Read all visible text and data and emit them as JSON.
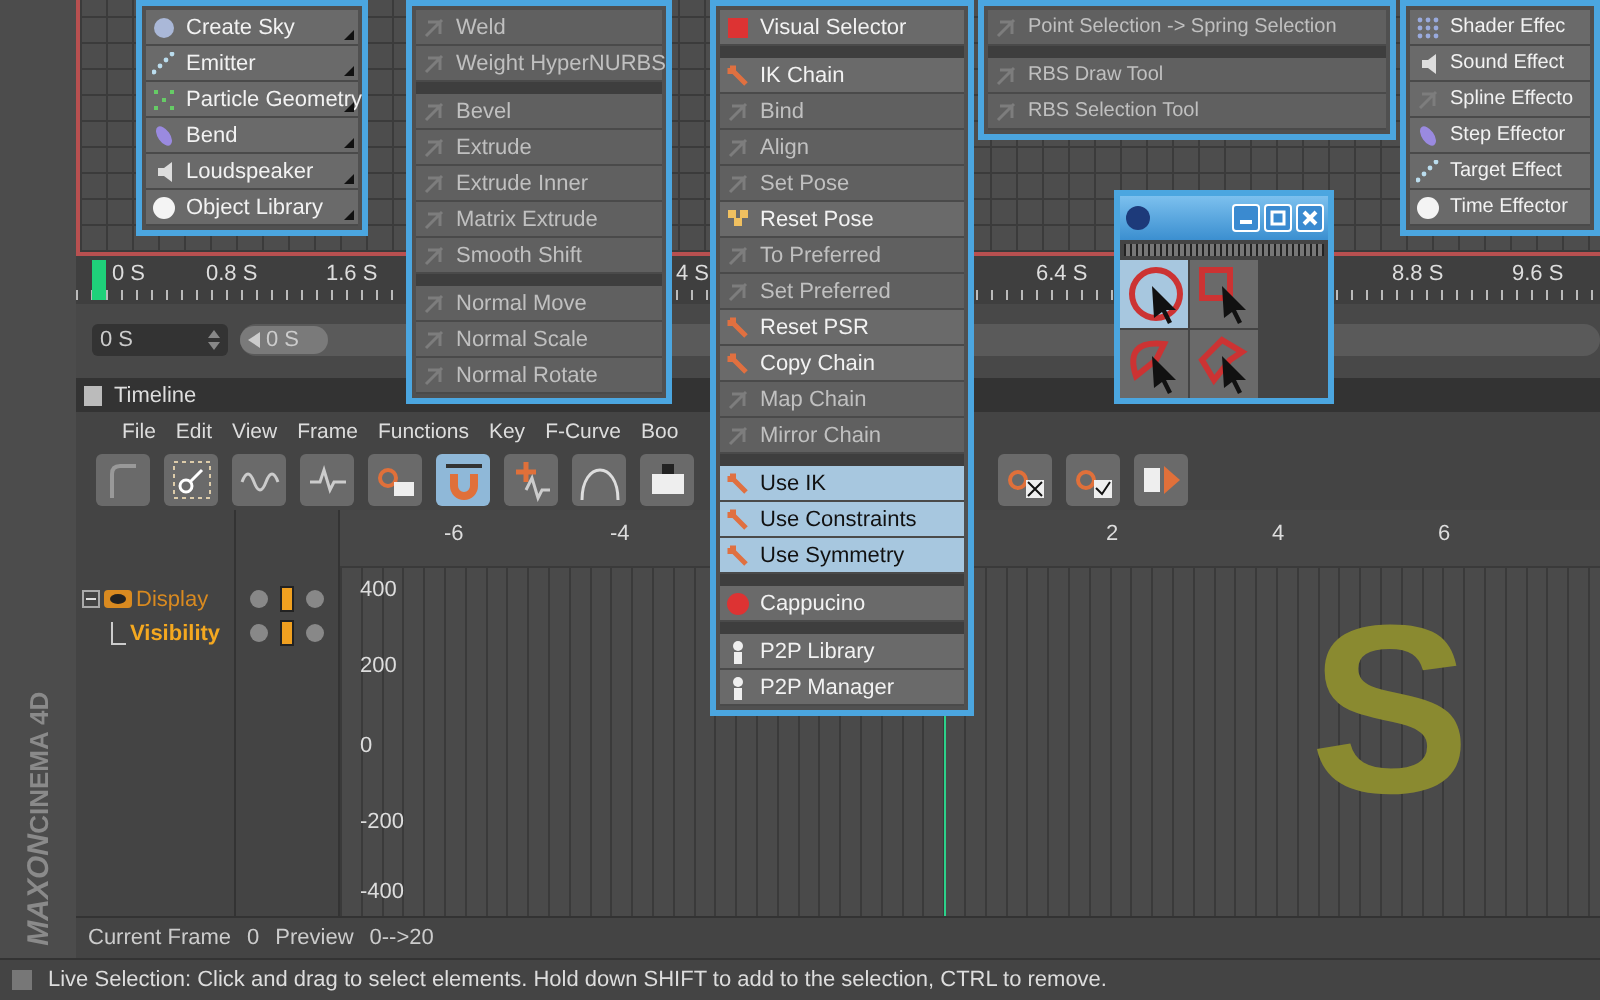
{
  "viewport": {
    "ruler": [
      "0 S",
      "0.8 S",
      "1.6 S",
      "4 S",
      "6.4 S",
      "8.8 S",
      "9.6 S"
    ],
    "frame_field": {
      "value": "0 S"
    },
    "time_slider": {
      "value": "0 S",
      "level": 0
    }
  },
  "menus": [
    {
      "items": [
        {
          "kind": "item",
          "label": "Create Sky",
          "disabled": false,
          "submenu": true
        },
        {
          "kind": "item",
          "label": "Emitter",
          "disabled": false,
          "submenu": true
        },
        {
          "kind": "item",
          "label": "Particle Geometry",
          "disabled": false,
          "submenu": true
        },
        {
          "kind": "item",
          "label": "Bend",
          "disabled": false,
          "submenu": true
        },
        {
          "kind": "item",
          "label": "Loudspeaker",
          "disabled": false,
          "submenu": true
        },
        {
          "kind": "item",
          "label": "Object Library",
          "disabled": false,
          "submenu": true
        }
      ]
    },
    {
      "items": [
        {
          "kind": "item",
          "label": "Weld",
          "disabled": true
        },
        {
          "kind": "item",
          "label": "Weight HyperNURBS",
          "disabled": true
        },
        {
          "kind": "separator"
        },
        {
          "kind": "item",
          "label": "Bevel",
          "disabled": true
        },
        {
          "kind": "item",
          "label": "Extrude",
          "disabled": true
        },
        {
          "kind": "item",
          "label": "Extrude Inner",
          "disabled": true
        },
        {
          "kind": "item",
          "label": "Matrix Extrude",
          "disabled": true
        },
        {
          "kind": "item",
          "label": "Smooth Shift",
          "disabled": true
        },
        {
          "kind": "separator"
        },
        {
          "kind": "item",
          "label": "Normal Move",
          "disabled": true
        },
        {
          "kind": "item",
          "label": "Normal Scale",
          "disabled": true
        },
        {
          "kind": "item",
          "label": "Normal Rotate",
          "disabled": true
        }
      ]
    },
    {
      "items": [
        {
          "kind": "item",
          "label": "Visual Selector",
          "disabled": false,
          "checked": false
        },
        {
          "kind": "separator"
        },
        {
          "kind": "item",
          "label": "IK Chain",
          "disabled": false,
          "checked": false
        },
        {
          "kind": "item",
          "label": "Bind",
          "disabled": true,
          "checked": false
        },
        {
          "kind": "item",
          "label": "Align",
          "disabled": true,
          "checked": false
        },
        {
          "kind": "item",
          "label": "Set Pose",
          "disabled": true,
          "checked": false
        },
        {
          "kind": "item",
          "label": "Reset Pose",
          "disabled": false,
          "checked": false
        },
        {
          "kind": "item",
          "label": "To Preferred",
          "disabled": true,
          "checked": false
        },
        {
          "kind": "item",
          "label": "Set Preferred",
          "disabled": true,
          "checked": false
        },
        {
          "kind": "item",
          "label": "Reset PSR",
          "disabled": false,
          "checked": false
        },
        {
          "kind": "item",
          "label": "Copy Chain",
          "disabled": false,
          "checked": false
        },
        {
          "kind": "item",
          "label": "Map Chain",
          "disabled": true,
          "checked": false
        },
        {
          "kind": "item",
          "label": "Mirror Chain",
          "disabled": true,
          "checked": false
        },
        {
          "kind": "separator"
        },
        {
          "kind": "item",
          "label": "Use IK",
          "disabled": false,
          "checked": true
        },
        {
          "kind": "item",
          "label": "Use Constraints",
          "disabled": false,
          "checked": true
        },
        {
          "kind": "item",
          "label": "Use Symmetry",
          "disabled": false,
          "checked": true
        },
        {
          "kind": "separator"
        },
        {
          "kind": "item",
          "label": "Cappucino",
          "disabled": false,
          "checked": false
        },
        {
          "kind": "separator"
        },
        {
          "kind": "item",
          "label": "P2P Library",
          "disabled": false,
          "checked": false
        },
        {
          "kind": "item",
          "label": "P2P Manager",
          "disabled": false,
          "checked": false
        }
      ]
    },
    {
      "items": [
        {
          "kind": "item",
          "label": "Point Selection -> Spring Selection",
          "disabled": true
        },
        {
          "kind": "separator"
        },
        {
          "kind": "item",
          "label": "RBS Draw Tool",
          "disabled": true
        },
        {
          "kind": "item",
          "label": "RBS Selection Tool",
          "disabled": true
        }
      ]
    },
    {
      "items": [
        {
          "kind": "item",
          "label": "Shader Effec",
          "disabled": false
        },
        {
          "kind": "item",
          "label": "Sound Effect",
          "disabled": false
        },
        {
          "kind": "item",
          "label": "Spline Effecto",
          "disabled": false
        },
        {
          "kind": "item",
          "label": "Step Effector",
          "disabled": false
        },
        {
          "kind": "item",
          "label": "Target Effect",
          "disabled": false
        },
        {
          "kind": "item",
          "label": "Time Effector",
          "disabled": false
        }
      ]
    }
  ],
  "selection_palette": {
    "tools": [
      {
        "kind": "live",
        "selected": true
      },
      {
        "kind": "rectangle",
        "selected": false
      },
      {
        "kind": "lasso",
        "selected": false
      },
      {
        "kind": "polygon",
        "selected": false
      }
    ]
  },
  "logo": {
    "line_1": "MAXON",
    "line_2": "CINEMA 4D"
  },
  "timeline": {
    "title": "Timeline",
    "menu": [
      "File",
      "Edit",
      "View",
      "Frame",
      "Functions",
      "Key",
      "F-Curve",
      "Boo"
    ],
    "toolbar": {
      "left": [
        {
          "kind": "curve",
          "selected": false
        },
        {
          "kind": "key",
          "selected": false
        },
        {
          "kind": "wave",
          "selected": false
        },
        {
          "kind": "spike",
          "selected": false
        },
        {
          "kind": "key-camera",
          "selected": false
        },
        {
          "kind": "magnet",
          "selected": true
        },
        {
          "kind": "plus-wave",
          "selected": false
        },
        {
          "kind": "arc",
          "selected": false
        },
        {
          "kind": "camera",
          "selected": false
        }
      ],
      "right": [
        {
          "kind": "key-x",
          "selected": false
        },
        {
          "kind": "key-check",
          "selected": false
        },
        {
          "kind": "frame",
          "selected": false
        }
      ]
    },
    "x_ticks": [
      "-6",
      "-4",
      "2",
      "4",
      "6"
    ],
    "y_ticks": [
      "400",
      "200",
      "0",
      "-200",
      "-400"
    ],
    "tracks": [
      {
        "label": "Display",
        "expanded": true,
        "children": [
          {
            "label": "Visibility"
          }
        ]
      }
    ],
    "overlay_text": "S",
    "footer": {
      "current_frame_label": "Current Frame",
      "current_frame": "0",
      "preview_label": "Preview",
      "preview": "0-->20"
    }
  },
  "status_bar": "Live Selection: Click and drag to select elements. Hold down SHIFT to add to the selection, CTRL to remove."
}
